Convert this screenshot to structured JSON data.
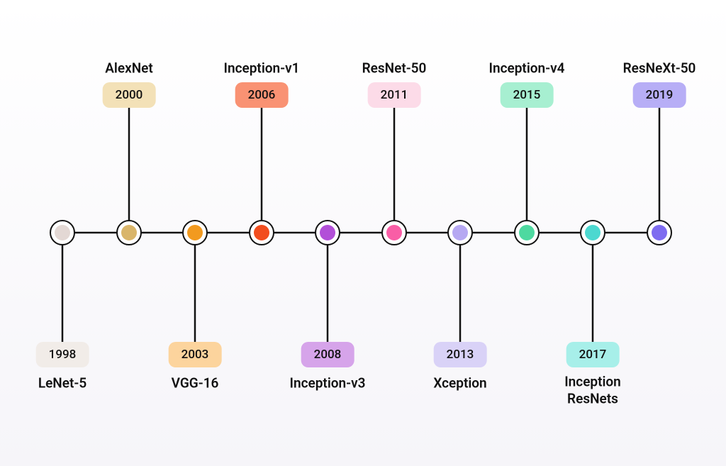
{
  "chart_data": {
    "type": "timeline",
    "title": "",
    "items": [
      {
        "year": "1998",
        "name": "LeNet-5",
        "position": "bottom",
        "color": "#e3d8d4",
        "pill": "#f1ece8"
      },
      {
        "year": "2000",
        "name": "AlexNet",
        "position": "top",
        "color": "#d9b56a",
        "pill": "#f3e1b7"
      },
      {
        "year": "2003",
        "name": "VGG-16",
        "position": "bottom",
        "color": "#f29a1f",
        "pill": "#fcd49d"
      },
      {
        "year": "2006",
        "name": "Inception-v1",
        "position": "top",
        "color": "#f24d1e",
        "pill": "#f99273"
      },
      {
        "year": "2008",
        "name": "Inception-v3",
        "position": "bottom",
        "color": "#b24fd8",
        "pill": "#d6a4ea"
      },
      {
        "year": "2011",
        "name": "ResNet-50",
        "position": "top",
        "color": "#f95ea6",
        "pill": "#fcdbe8"
      },
      {
        "year": "2013",
        "name": "Xception",
        "position": "bottom",
        "color": "#b6a8f2",
        "pill": "#d9d2f7"
      },
      {
        "year": "2015",
        "name": "Inception-v4",
        "position": "top",
        "color": "#4ed9a0",
        "pill": "#a7efd1"
      },
      {
        "year": "2017",
        "name": "Inception\nResNets",
        "position": "bottom",
        "color": "#4cd8d0",
        "pill": "#a7efe9"
      },
      {
        "year": "2019",
        "name": "ResNeXt-50",
        "position": "top",
        "color": "#7e6cf0",
        "pill": "#b7aef6"
      }
    ]
  },
  "layout": {
    "axisY": 328,
    "startX": 88,
    "endX": 930,
    "pillTopY": 134,
    "labelTopY": 96,
    "pillBotY": 500,
    "labelBotY": 540,
    "labelBotMultiY": 550
  }
}
